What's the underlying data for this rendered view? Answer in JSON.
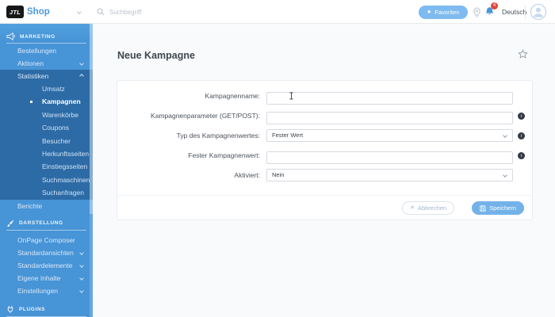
{
  "header": {
    "logo_text": "JTL",
    "brand": "Shop",
    "search_placeholder": "Suchbegriff",
    "favorites_label": "Favoriten",
    "notifications_count": "4",
    "language": "Deutsch"
  },
  "sidebar": {
    "marketing": {
      "title": "MARKETING",
      "items": [
        "Bestellungen",
        "Aktionen",
        "Statistiken"
      ],
      "statistiken_children": [
        "Umsatz",
        "Kampagnen",
        "Warenkörbe",
        "Coupons",
        "Besucher",
        "Herkunftsseiten",
        "Einstiegsseiten",
        "Suchmaschinen",
        "Suchanfragen"
      ],
      "active_child": "Kampagnen",
      "berichte": "Berichte"
    },
    "darstellung": {
      "title": "DARSTELLUNG",
      "items": [
        "OnPage Composer",
        "Standardansichten",
        "Standardelemente",
        "Eigene Inhalte",
        "Einstellungen"
      ]
    },
    "plugins": {
      "title": "PLUGINS"
    }
  },
  "page": {
    "title": "Neue Kampagne"
  },
  "form": {
    "fields": [
      {
        "label": "Kampagnenname:",
        "type": "text",
        "value": "",
        "info": false
      },
      {
        "label": "Kampagnenparameter (GET/POST):",
        "type": "text",
        "value": "",
        "info": true
      },
      {
        "label": "Typ des Kampagnenwertes:",
        "type": "select",
        "value": "Fester Wert",
        "info": true
      },
      {
        "label": "Fester Kampagnenwert:",
        "type": "text",
        "value": "",
        "info": true
      },
      {
        "label": "Aktiviert:",
        "type": "select",
        "value": "Nein",
        "info": false
      }
    ],
    "buttons": {
      "cancel": "Abbrechen",
      "save": "Speichern"
    }
  },
  "colors": {
    "accent": "#4a99dc",
    "sidebar": "#4794d6",
    "sidebar_expanded": "#2d6ba6",
    "badge": "#e2463c",
    "save_button": "#72b2e9",
    "favorites_button": "#7ebbf0"
  }
}
